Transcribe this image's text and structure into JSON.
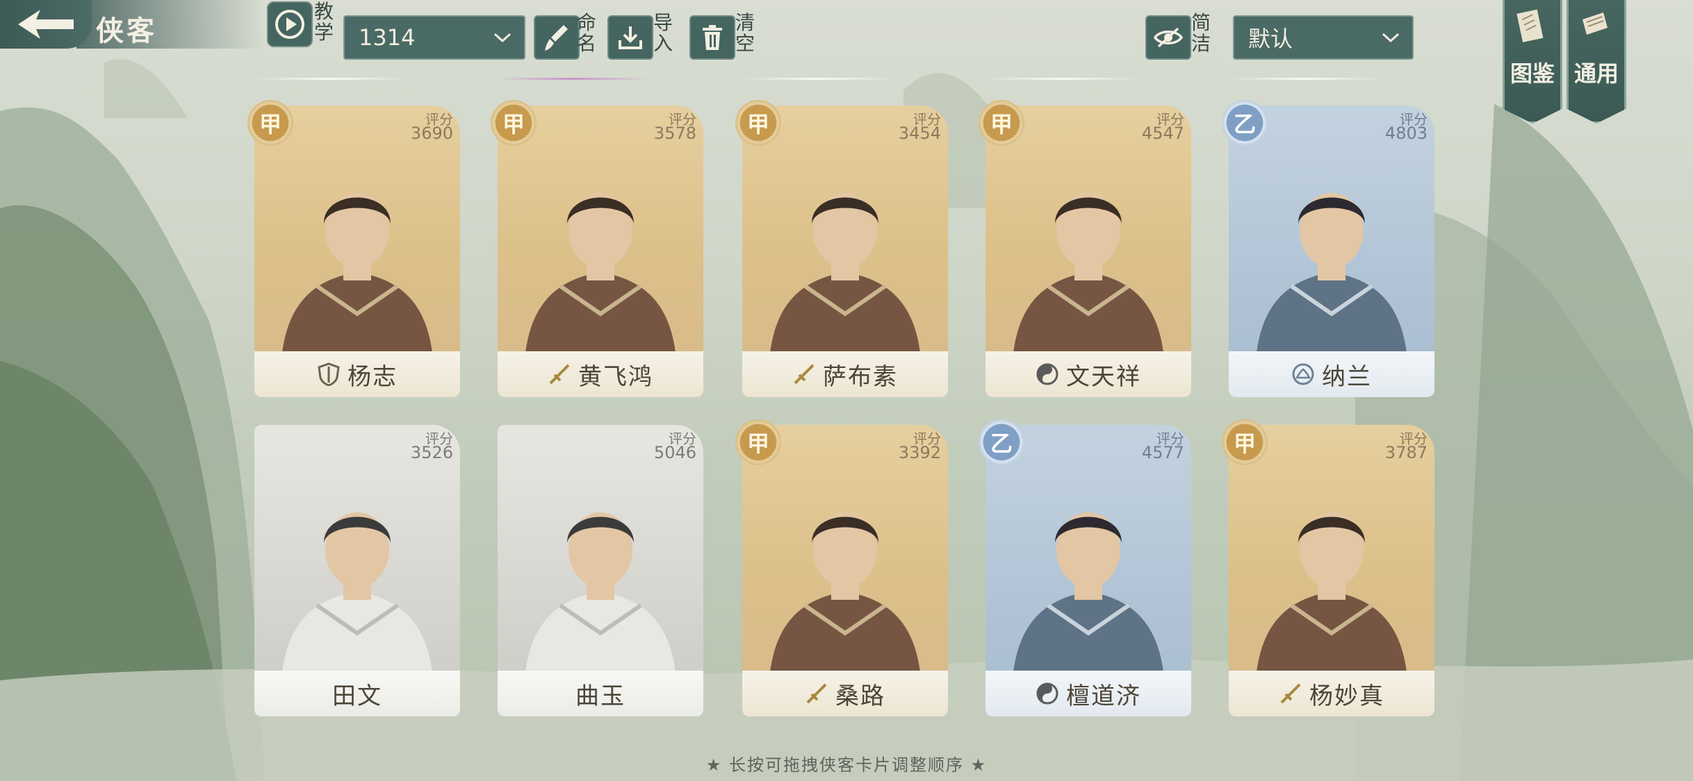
{
  "header": {
    "title": "侠客",
    "tutorial_label": "教学",
    "team_select": "1314",
    "rename_label": "命名",
    "import_label": "导入",
    "clear_label": "清空",
    "simple_label": "简洁",
    "sort_select": "默认",
    "codex_label": "图鉴",
    "common_label": "通用"
  },
  "score_label": "评分",
  "cards": [
    {
      "name": "杨志",
      "grade": "甲",
      "score": "3690",
      "rarity": "gold",
      "role_icon": "shield-icon"
    },
    {
      "name": "黄飞鸿",
      "grade": "甲",
      "score": "3578",
      "rarity": "gold",
      "role_icon": "sword-icon"
    },
    {
      "name": "萨布素",
      "grade": "甲",
      "score": "3454",
      "rarity": "gold",
      "role_icon": "sword-icon"
    },
    {
      "name": "文天祥",
      "grade": "甲",
      "score": "4547",
      "rarity": "gold",
      "role_icon": "yin-yang-icon"
    },
    {
      "name": "纳兰",
      "grade": "乙",
      "score": "4803",
      "rarity": "blue",
      "role_icon": "lotus-icon"
    },
    {
      "name": "田文",
      "grade": "",
      "score": "3526",
      "rarity": "silver",
      "role_icon": ""
    },
    {
      "name": "曲玉",
      "grade": "",
      "score": "5046",
      "rarity": "silver",
      "role_icon": ""
    },
    {
      "name": "桑路",
      "grade": "甲",
      "score": "3392",
      "rarity": "gold",
      "role_icon": "sword-icon"
    },
    {
      "name": "檀道济",
      "grade": "乙",
      "score": "4577",
      "rarity": "blue",
      "role_icon": "yin-yang-icon"
    },
    {
      "name": "杨妙真",
      "grade": "甲",
      "score": "3787",
      "rarity": "gold",
      "role_icon": "sword-icon"
    }
  ],
  "footer_hint": "★ 长按可拖拽侠客卡片调整顺序 ★",
  "colors": {
    "header_teal": "#456560",
    "gold_card": "#dcc08a",
    "blue_card": "#b1c4d6",
    "silver_card": "#d6d5d0"
  }
}
